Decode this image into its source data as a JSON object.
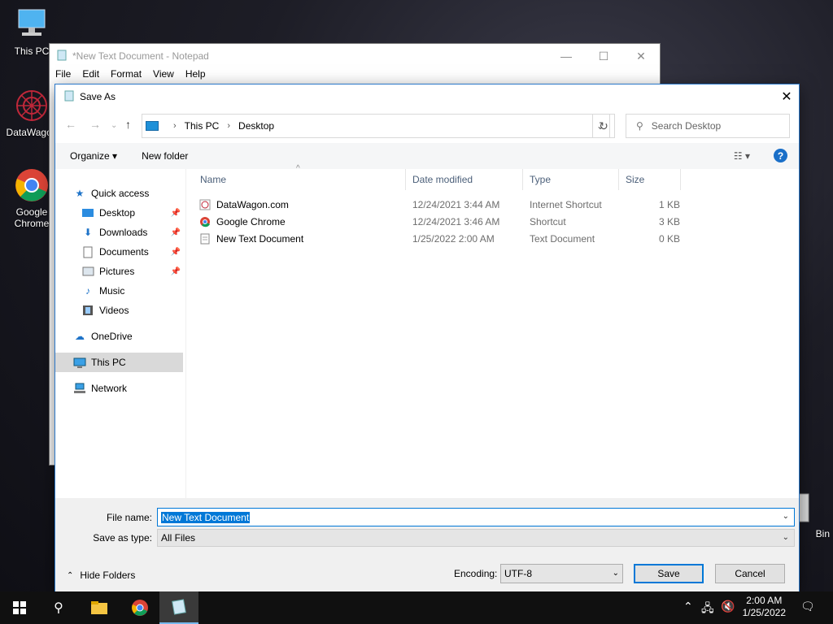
{
  "desktop": {
    "icons": [
      {
        "label": "This PC"
      },
      {
        "label": "DataWagon"
      },
      {
        "label": "Google Chrome"
      },
      {
        "label": "Bin"
      }
    ]
  },
  "notepad": {
    "title": "*New Text Document - Notepad",
    "menu": [
      "File",
      "Edit",
      "Format",
      "View",
      "Help"
    ]
  },
  "dialog": {
    "title": "Save As",
    "breadcrumb": [
      "This PC",
      "Desktop"
    ],
    "search_placeholder": "Search Desktop",
    "toolbar": {
      "organize": "Organize",
      "new_folder": "New folder"
    },
    "sidebar": [
      {
        "label": "Quick access",
        "icon": "star-icon",
        "pinned": false
      },
      {
        "label": "Desktop",
        "icon": "desktop-folder-icon",
        "pinned": true
      },
      {
        "label": "Downloads",
        "icon": "download-arrow-icon",
        "pinned": true
      },
      {
        "label": "Documents",
        "icon": "document-icon",
        "pinned": true
      },
      {
        "label": "Pictures",
        "icon": "picture-icon",
        "pinned": true
      },
      {
        "label": "Music",
        "icon": "music-note-icon",
        "pinned": false
      },
      {
        "label": "Videos",
        "icon": "film-icon",
        "pinned": false
      },
      {
        "label": "OneDrive",
        "icon": "cloud-icon",
        "pinned": false
      },
      {
        "label": "This PC",
        "icon": "computer-icon",
        "pinned": false,
        "selected": true
      },
      {
        "label": "Network",
        "icon": "network-icon",
        "pinned": false
      }
    ],
    "columns": [
      "Name",
      "Date modified",
      "Type",
      "Size"
    ],
    "files": [
      {
        "name": "DataWagon.com",
        "date": "12/24/2021 3:44 AM",
        "type": "Internet Shortcut",
        "size": "1 KB",
        "icon": "internet-shortcut-icon"
      },
      {
        "name": "Google Chrome",
        "date": "12/24/2021 3:46 AM",
        "type": "Shortcut",
        "size": "3 KB",
        "icon": "chrome-icon"
      },
      {
        "name": "New Text Document",
        "date": "1/25/2022 2:00 AM",
        "type": "Text Document",
        "size": "0 KB",
        "icon": "text-file-icon"
      }
    ],
    "file_name_label": "File name:",
    "file_name_value": "New Text Document",
    "save_type_label": "Save as type:",
    "save_type_value": "All Files",
    "hide_folders": "Hide Folders",
    "encoding_label": "Encoding:",
    "encoding_value": "UTF-8",
    "save_button": "Save",
    "cancel_button": "Cancel"
  },
  "taskbar": {
    "time": "2:00 AM",
    "date": "1/25/2022"
  },
  "colors": {
    "accent": "#0078d7",
    "taskbar": "#101010",
    "selected_sidebar": "#d9d9d9"
  }
}
